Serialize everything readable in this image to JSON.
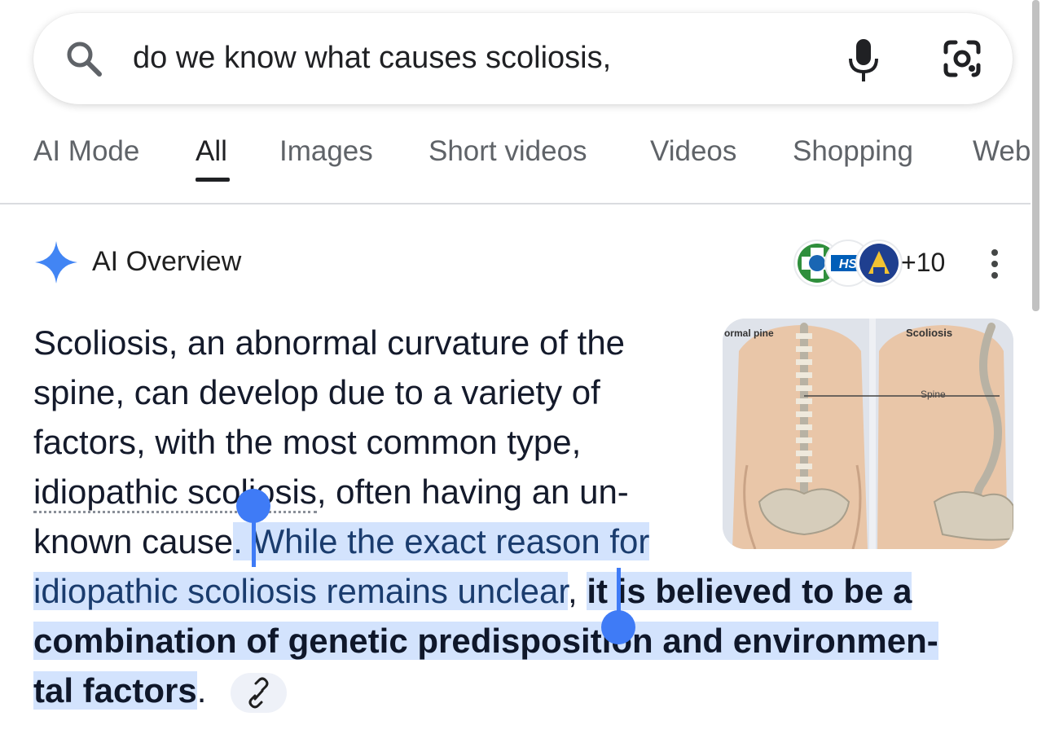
{
  "search": {
    "query": "do we know what causes scoliosis,"
  },
  "tabs": [
    {
      "label": "AI Mode",
      "active": false
    },
    {
      "label": "All",
      "active": true
    },
    {
      "label": "Images",
      "active": false
    },
    {
      "label": "Short videos",
      "active": false
    },
    {
      "label": "Videos",
      "active": false
    },
    {
      "label": "Shopping",
      "active": false
    },
    {
      "label": "Web",
      "active": false
    }
  ],
  "overview": {
    "title": "AI Overview",
    "source_count": "+10",
    "logo_text": "HS",
    "lines": {
      "l1": "Scoliosis, an abnormal curvature of the",
      "l2": "spine, can develop due to a variety of",
      "l3": "factors, with the most common type,",
      "l4_link": "idiopathic scoliosis",
      "l4_rest": ", often having an un-",
      "l5_plain": "known cause",
      "l5_sel": ". While the exact reason for",
      "l6_sel": "idiopathic scoliosis remains unclear",
      "l6_comma": ", ",
      "l6_bold": "it is believed to be a",
      "l7_bold": "combination of genetic predisposition and environmen-",
      "l8_bold": "tal factors",
      "l8_end": "."
    },
    "image_labels": {
      "left": "ormal\npine",
      "right": "Scoliosis",
      "spine": "Spine"
    }
  },
  "colors": {
    "accent": "#3f7bf6",
    "selection": "#d3e3fd",
    "sparkle": "#4285f4"
  }
}
